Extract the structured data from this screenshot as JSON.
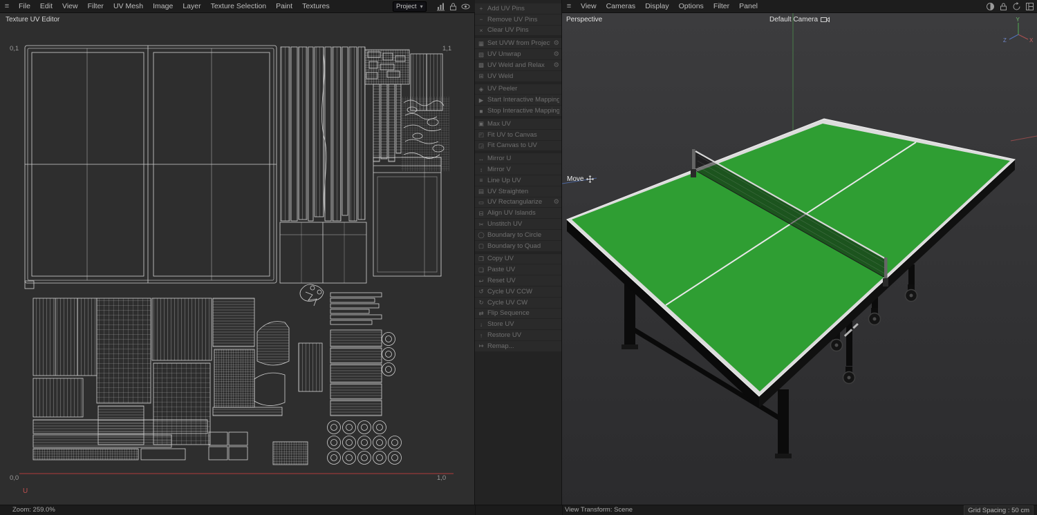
{
  "icons": {
    "hamburger": "≡",
    "caret": "▾",
    "gear": "⚙"
  },
  "menubar_left": {
    "items": [
      "File",
      "Edit",
      "View",
      "Filter",
      "UV Mesh",
      "Image",
      "Layer",
      "Texture Selection",
      "Paint",
      "Textures"
    ]
  },
  "project_dropdown": {
    "label": "Project"
  },
  "menubar_right": {
    "items": [
      "View",
      "Cameras",
      "Display",
      "Options",
      "Filter",
      "Panel"
    ]
  },
  "uv_editor": {
    "title": "Texture UV Editor",
    "corners": {
      "top_left": "0,1",
      "top_right": "1,1",
      "bottom_left": "0,0",
      "bottom_right": "1,0"
    },
    "u_axis_label": "U",
    "zoom_status": "Zoom: 259.0%"
  },
  "commands_panel": {
    "groups": [
      [
        {
          "icon": "+",
          "label": "Add UV Pins"
        },
        {
          "icon": "−",
          "label": "Remove UV Pins"
        },
        {
          "icon": "×",
          "label": "Clear UV Pins"
        }
      ],
      [
        {
          "icon": "▦",
          "label": "Set UVW from Projection",
          "gear": true
        },
        {
          "icon": "▧",
          "label": "UV Unwrap",
          "gear": true
        },
        {
          "icon": "▩",
          "label": "UV Weld and Relax",
          "gear": true
        },
        {
          "icon": "⊞",
          "label": "UV Weld"
        }
      ],
      [
        {
          "icon": "◈",
          "label": "UV Peeler"
        },
        {
          "icon": "▶",
          "label": "Start Interactive Mapping"
        },
        {
          "icon": "■",
          "label": "Stop Interactive Mapping"
        }
      ],
      [
        {
          "icon": "▣",
          "label": "Max UV"
        },
        {
          "icon": "◰",
          "label": "Fit UV to Canvas"
        },
        {
          "icon": "◲",
          "label": "Fit Canvas to UV"
        }
      ],
      [
        {
          "icon": "↔",
          "label": "Mirror U"
        },
        {
          "icon": "↕",
          "label": "Mirror V"
        },
        {
          "icon": "≡",
          "label": "Line Up UV"
        },
        {
          "icon": "▤",
          "label": "UV Straighten"
        },
        {
          "icon": "▭",
          "label": "UV Rectangularize",
          "gear": true
        },
        {
          "icon": "⊟",
          "label": "Align UV Islands"
        },
        {
          "icon": "✂",
          "label": "Unstitch UV"
        },
        {
          "icon": "◯",
          "label": "Boundary to Circle"
        },
        {
          "icon": "▢",
          "label": "Boundary to Quad"
        }
      ],
      [
        {
          "icon": "❐",
          "label": "Copy UV"
        },
        {
          "icon": "❏",
          "label": "Paste UV"
        },
        {
          "icon": "↩",
          "label": "Reset UV"
        },
        {
          "icon": "↺",
          "label": "Cycle UV CCW"
        },
        {
          "icon": "↻",
          "label": "Cycle UV CW"
        },
        {
          "icon": "⇄",
          "label": "Flip Sequence"
        },
        {
          "icon": "↓",
          "label": "Store UV"
        },
        {
          "icon": "↑",
          "label": "Restore UV"
        },
        {
          "icon": "↦",
          "label": "Remap..."
        }
      ]
    ]
  },
  "viewport": {
    "view_label": "Perspective",
    "camera_label": "Default Camera",
    "tool_label": "Move",
    "axis_gizmo": {
      "x": "X",
      "y": "Y",
      "z": "Z"
    },
    "colors": {
      "table_green": "#2f9e33",
      "table_rim": "#dcdcdc",
      "axis_x": "#a85050",
      "axis_y": "#4f9b4f",
      "axis_z": "#5272b8"
    },
    "status_left": "View Transform: Scene",
    "status_right": "Grid Spacing : 50 cm"
  }
}
